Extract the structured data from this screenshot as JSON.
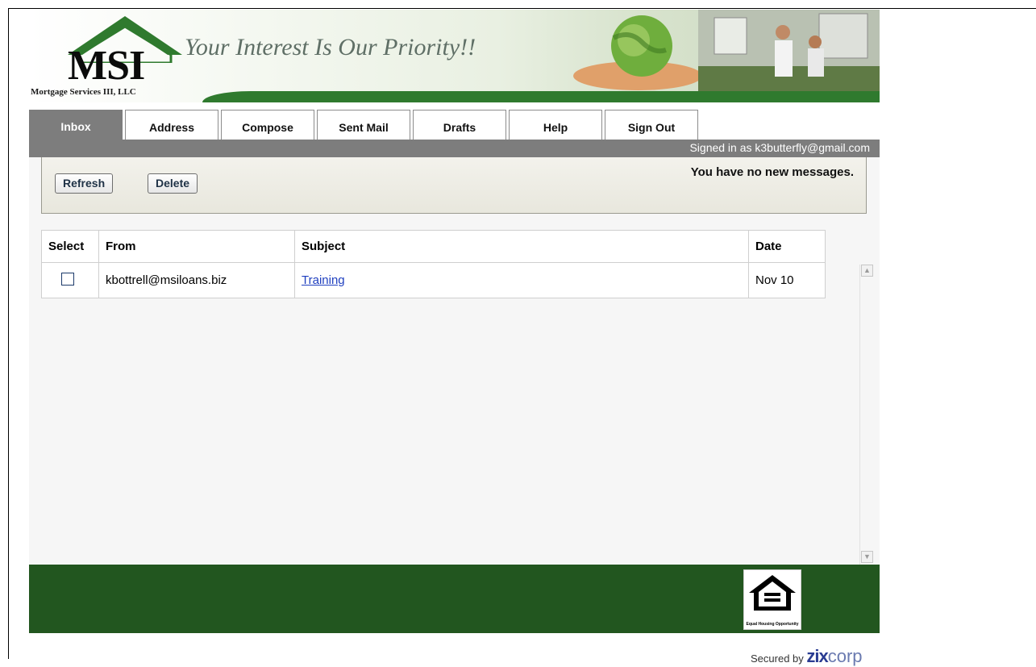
{
  "header": {
    "logo": "MSI",
    "company": "Mortgage Services III, LLC",
    "tagline": "Your Interest Is Our Priority!!"
  },
  "tabs": [
    {
      "label": "Inbox",
      "active": true
    },
    {
      "label": "Address"
    },
    {
      "label": "Compose"
    },
    {
      "label": "Sent Mail"
    },
    {
      "label": "Drafts"
    },
    {
      "label": "Help"
    },
    {
      "label": "Sign Out"
    }
  ],
  "signin": "Signed in as k3butterfly@gmail.com",
  "toolbar": {
    "refresh": "Refresh",
    "delete": "Delete",
    "status": "You have no new messages."
  },
  "table": {
    "headers": [
      "Select",
      "From",
      "Subject",
      "Date"
    ],
    "rows": [
      {
        "from": "kbottrell@msiloans.biz",
        "subject": "Training",
        "date": "Nov 10"
      }
    ]
  },
  "footer": {
    "eho_label": "Equal Housing Opportunity",
    "secured_by": "Secured by",
    "zix": "zix",
    "corp": "corp"
  },
  "colors": {
    "banner_green": "#2f7a2e",
    "footer_green": "#22561f",
    "tab_gray": "#7d7d7d",
    "link_blue": "#1f3fbf"
  }
}
